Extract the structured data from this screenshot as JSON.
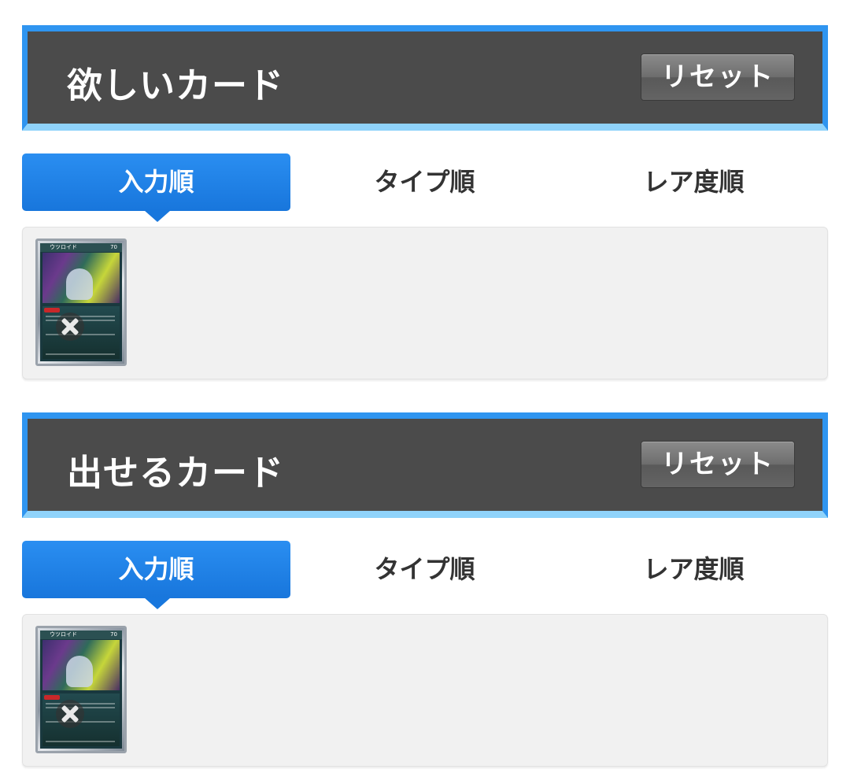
{
  "wanted": {
    "title": "欲しいカード",
    "reset_label": "リセット",
    "tabs": [
      {
        "label": "入力順",
        "active": true
      },
      {
        "label": "タイプ順",
        "active": false
      },
      {
        "label": "レア度順",
        "active": false
      }
    ],
    "cards": [
      {
        "name": "ウツロイド",
        "hp": "70"
      }
    ]
  },
  "offer": {
    "title": "出せるカード",
    "reset_label": "リセット",
    "tabs": [
      {
        "label": "入力順",
        "active": true
      },
      {
        "label": "タイプ順",
        "active": false
      },
      {
        "label": "レア度順",
        "active": false
      }
    ],
    "cards": [
      {
        "name": "ウツロイド",
        "hp": "70"
      }
    ]
  },
  "colors": {
    "header_border": "#2f95f0",
    "header_bottom": "#8fd3fb",
    "header_bg": "#4b4b4b",
    "active_tab": "#1f82e6",
    "panel_bg": "#f1f1f1"
  },
  "icons": {
    "remove": "close-x-icon"
  }
}
